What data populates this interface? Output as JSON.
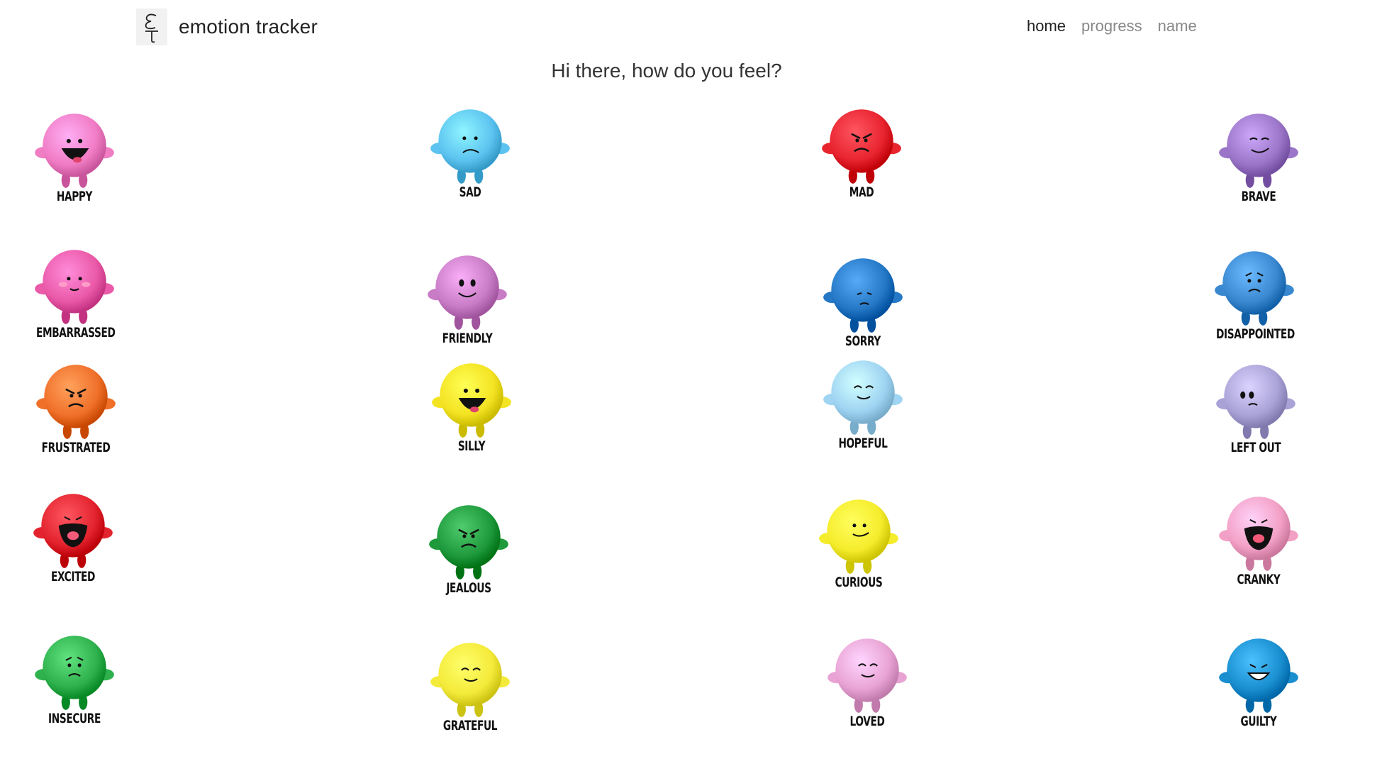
{
  "brand": {
    "name": "emotion tracker",
    "logo_icon": "e-t-logo-icon"
  },
  "nav": [
    {
      "label": "home",
      "active": true
    },
    {
      "label": "progress",
      "active": false
    },
    {
      "label": "name",
      "active": false
    }
  ],
  "greeting": "Hi there, how do you feel?",
  "emotions": [
    {
      "label": "HAPPY",
      "color": "#f07cc4",
      "face": "laugh"
    },
    {
      "label": "SAD",
      "color": "#5cc3f0",
      "face": "sad"
    },
    {
      "label": "MAD",
      "color": "#e8242f",
      "face": "mad"
    },
    {
      "label": "BRAVE",
      "color": "#9b76c8",
      "face": "smug"
    },
    {
      "label": "EMBARRASSED",
      "color": "#ea5aa8",
      "face": "shy"
    },
    {
      "label": "FRIENDLY",
      "color": "#c97cc6",
      "face": "smile"
    },
    {
      "label": "SORRY",
      "color": "#2478c6",
      "face": "down"
    },
    {
      "label": "DISAPPOINTED",
      "color": "#3a88d0",
      "face": "worried"
    },
    {
      "label": "FRUSTRATED",
      "color": "#f0702a",
      "face": "mad"
    },
    {
      "label": "SILLY",
      "color": "#f3e323",
      "face": "laugh"
    },
    {
      "label": "HOPEFUL",
      "color": "#9fd4f2",
      "face": "content"
    },
    {
      "label": "LEFT OUT",
      "color": "#a9a2d6",
      "face": "sideeye"
    },
    {
      "label": "EXCITED",
      "color": "#e3242f",
      "face": "shout"
    },
    {
      "label": "JEALOUS",
      "color": "#1e9a3c",
      "face": "mad"
    },
    {
      "label": "CURIOUS",
      "color": "#f5ec2c",
      "face": "smirk"
    },
    {
      "label": "CRANKY",
      "color": "#f3a0c6",
      "face": "shout"
    },
    {
      "label": "INSECURE",
      "color": "#2fb14d",
      "face": "worried"
    },
    {
      "label": "GRATEFUL",
      "color": "#f4ea3a",
      "face": "content"
    },
    {
      "label": "LOVED",
      "color": "#e8a3d4",
      "face": "content"
    },
    {
      "label": "GUILTY",
      "color": "#1a8fd0",
      "face": "grin"
    }
  ]
}
